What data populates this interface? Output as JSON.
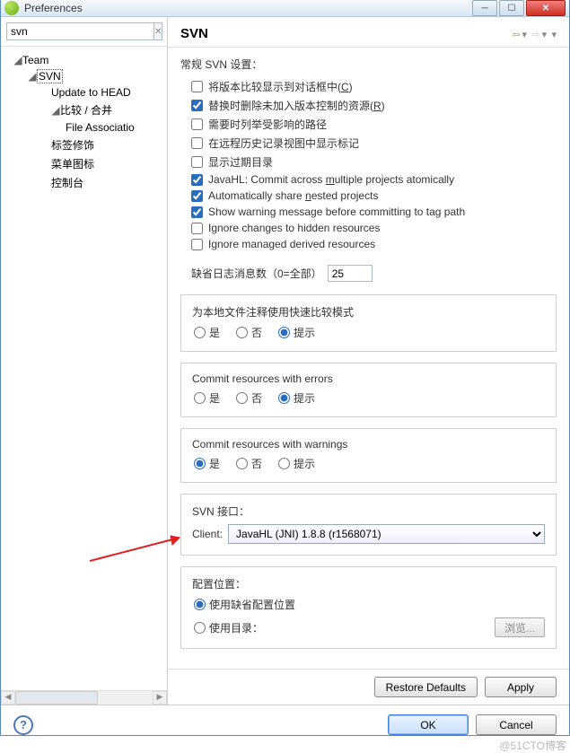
{
  "window": {
    "title": "Preferences"
  },
  "search": {
    "value": "svn"
  },
  "tree": {
    "team": "Team",
    "svn": "SVN",
    "update_to_head": "Update to HEAD",
    "compare_merge": "比较 / 合并",
    "file_assoc": "File Associatio",
    "label_decor": "标签修饰",
    "menu_icons": "菜单图标",
    "console": "控制台"
  },
  "page": {
    "title": "SVN",
    "general_heading": "常规 SVN 设置：",
    "checks": {
      "show_compare_dialog": "将版本比较显示到对话框中(C)",
      "remove_unversioned_on_replace": "替换时删除未加入版本控制的资源(R)",
      "list_affected_paths": "需要时列举受影响的路径",
      "show_tags_in_history": "在远程历史记录视图中显示标记",
      "show_out_of_date": "显示过期目录",
      "javahl_atomic": "JavaHL: Commit across multiple projects atomically",
      "auto_share_nested": "Automatically share nested projects",
      "warn_commit_tag": "Show warning message before committing to tag path",
      "ignore_hidden": "Ignore changes to hidden resources",
      "ignore_derived": "Ignore managed derived resources"
    },
    "log_count_label": "缺省日志消息数（0=全部）",
    "log_count_value": "25",
    "radio": {
      "yes": "是",
      "no": "否",
      "prompt": "提示"
    },
    "quick_diff_label": "为本地文件注释使用快速比较模式",
    "commit_errors_label": "Commit resources with errors",
    "commit_warnings_label": "Commit resources with warnings",
    "interface_heading": "SVN 接口：",
    "client_label": "Client:",
    "client_value": "JavaHL (JNI) 1.8.8 (r1568071)",
    "config_heading": "配置位置：",
    "use_default_cfg": "使用缺省配置位置",
    "use_dir": "使用目录：",
    "browse": "浏览...",
    "restore_defaults": "Restore Defaults",
    "apply": "Apply"
  },
  "buttons": {
    "ok": "OK",
    "cancel": "Cancel"
  },
  "watermark": "@51CTO博客"
}
